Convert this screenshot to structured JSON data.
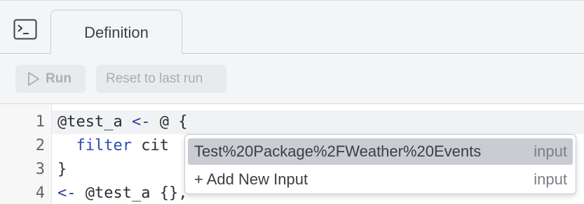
{
  "tabs": [
    {
      "label": "Definition",
      "active": true
    }
  ],
  "toolbar": {
    "run_label": "Run",
    "reset_label": "Reset to last run"
  },
  "editor": {
    "lines": [
      {
        "number": "1",
        "parts": [
          "@test_a ",
          "<-",
          " @ {"
        ]
      },
      {
        "number": "2",
        "parts": [
          "  ",
          "filter",
          " cit"
        ]
      },
      {
        "number": "3",
        "parts": [
          "}"
        ]
      },
      {
        "number": "4",
        "parts": [
          "<-",
          " @test_a {},"
        ]
      }
    ]
  },
  "autocomplete": {
    "items": [
      {
        "label": "Test%20Package%2FWeather%20Events",
        "type": "input",
        "selected": true
      },
      {
        "label": "+ Add New Input",
        "type": "input",
        "selected": false
      }
    ]
  },
  "colors": {
    "keyword": "#2a4fb0",
    "selection": "#c9ccd1",
    "toolbar_bg": "#f4f5f6"
  },
  "icons": {
    "console": "terminal-icon",
    "run": "play-icon"
  }
}
